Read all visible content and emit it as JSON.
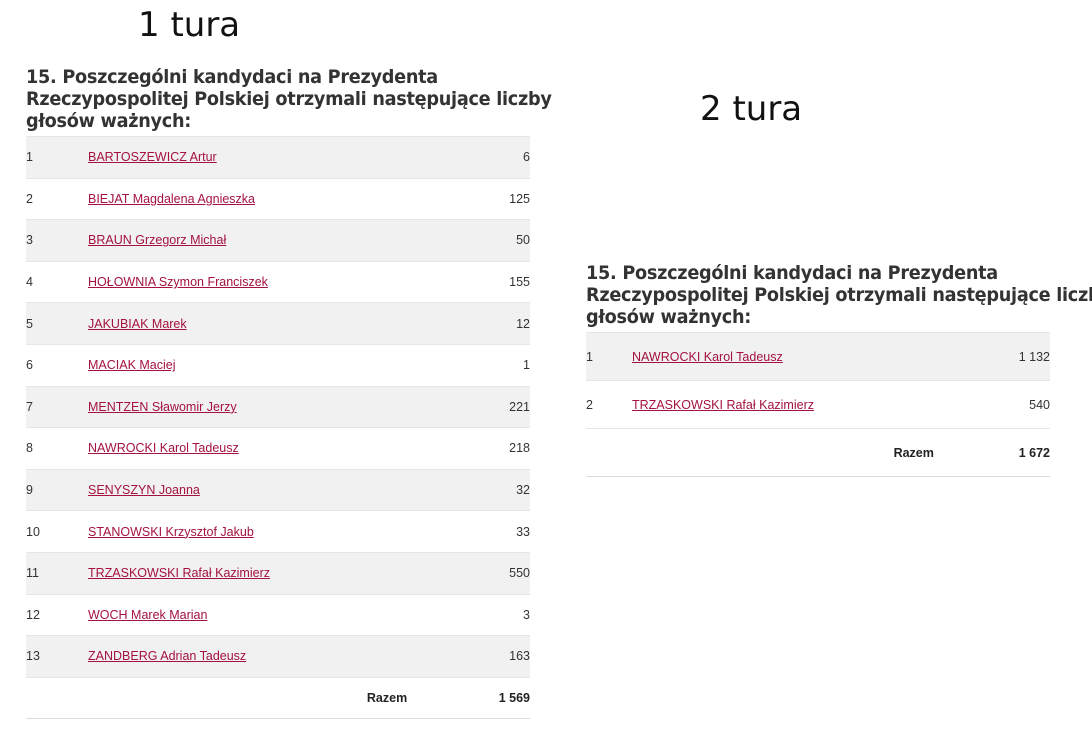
{
  "round1": {
    "title": "1 tura",
    "heading": [
      "15. Poszczególni kandydaci na Prezydenta",
      "Rzeczypospolitej Polskiej otrzymali następujące liczby",
      "głosów ważnych:"
    ],
    "candidates": [
      {
        "no": "1",
        "name": "BARTOSZEWICZ Artur",
        "votes": "6"
      },
      {
        "no": "2",
        "name": "BIEJAT Magdalena Agnieszka",
        "votes": "125"
      },
      {
        "no": "3",
        "name": "BRAUN Grzegorz Michał",
        "votes": "50"
      },
      {
        "no": "4",
        "name": "HOŁOWNIA Szymon Franciszek",
        "votes": "155"
      },
      {
        "no": "5",
        "name": "JAKUBIAK Marek",
        "votes": "12"
      },
      {
        "no": "6",
        "name": "MACIAK Maciej",
        "votes": "1"
      },
      {
        "no": "7",
        "name": "MENTZEN Sławomir Jerzy",
        "votes": "221"
      },
      {
        "no": "8",
        "name": "NAWROCKI Karol Tadeusz",
        "votes": "218"
      },
      {
        "no": "9",
        "name": "SENYSZYN Joanna",
        "votes": "32"
      },
      {
        "no": "10",
        "name": "STANOWSKI Krzysztof Jakub",
        "votes": "33"
      },
      {
        "no": "11",
        "name": "TRZASKOWSKI Rafał Kazimierz",
        "votes": "550"
      },
      {
        "no": "12",
        "name": "WOCH Marek Marian",
        "votes": "3"
      },
      {
        "no": "13",
        "name": "ZANDBERG Adrian Tadeusz",
        "votes": "163"
      }
    ],
    "total_label": "Razem",
    "total_value": "1 569"
  },
  "round2": {
    "title": "2 tura",
    "heading": [
      "15. Poszczególni kandydaci na Prezydenta",
      "Rzeczypospolitej Polskiej otrzymali następujące liczby",
      "głosów ważnych:"
    ],
    "candidates": [
      {
        "no": "1",
        "name": "NAWROCKI Karol Tadeusz",
        "votes": "1 132"
      },
      {
        "no": "2",
        "name": "TRZASKOWSKI Rafał Kazimierz",
        "votes": "540"
      }
    ],
    "total_label": "Razem",
    "total_value": "1 672"
  },
  "colors": {
    "link": "#a4123f",
    "row_shade": "#f1f1f1"
  }
}
